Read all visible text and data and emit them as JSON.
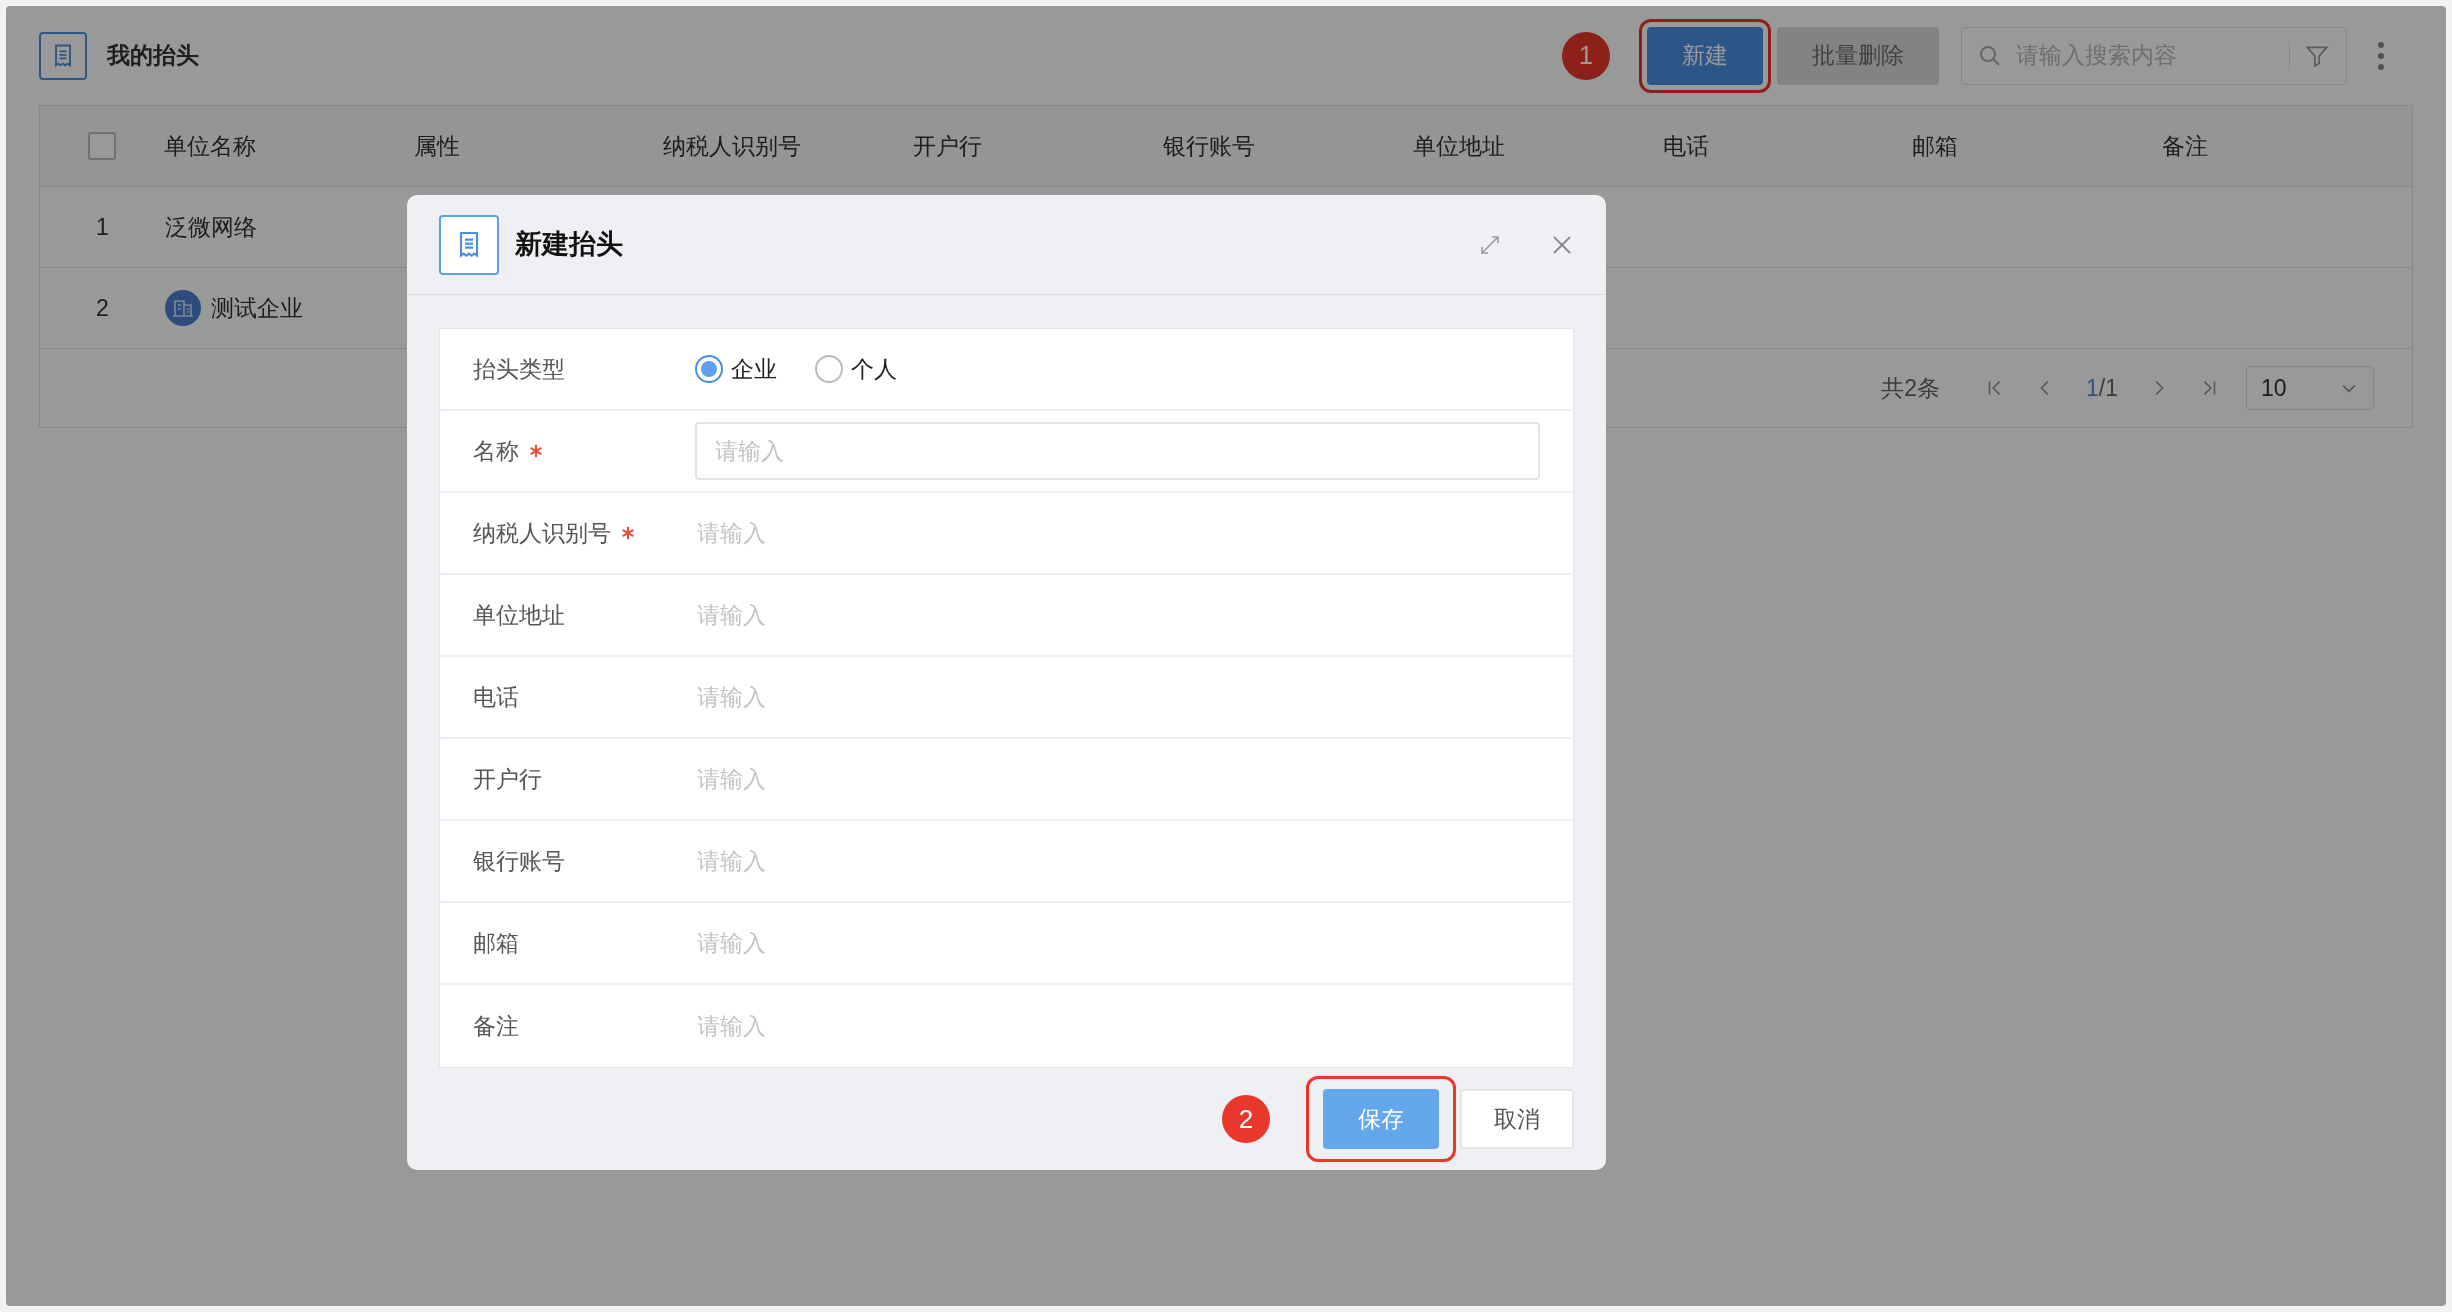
{
  "page": {
    "title": "我的抬头"
  },
  "toolbar": {
    "annotation": "1",
    "new_button": "新建",
    "batch_delete": {
      "label": "批量删除",
      "disabled": true
    },
    "search": {
      "placeholder": "请输入搜索内容"
    }
  },
  "table": {
    "select_all_checked": false,
    "columns": [
      "单位名称",
      "属性",
      "纳税人识别号",
      "开户行",
      "银行账号",
      "单位地址",
      "电话",
      "邮箱",
      "备注"
    ],
    "rows": [
      {
        "index": "1",
        "name": "泛微网络",
        "icon": false
      },
      {
        "index": "2",
        "name": "测试企业",
        "icon": true
      }
    ]
  },
  "pagination": {
    "total": "共2条",
    "current": "1",
    "rest": "/1",
    "page_size": "10"
  },
  "dialog": {
    "title": "新建抬头",
    "fields": [
      {
        "label": "抬头类型",
        "required": false,
        "kind": "radio",
        "options": [
          {
            "label": "企业",
            "selected": true
          },
          {
            "label": "个人",
            "selected": false
          }
        ]
      },
      {
        "label": "名称",
        "required": true,
        "kind": "boxed",
        "placeholder": "请输入"
      },
      {
        "label": "纳税人识别号",
        "required": true,
        "kind": "plain",
        "placeholder": "请输入"
      },
      {
        "label": "单位地址",
        "required": false,
        "kind": "plain",
        "placeholder": "请输入"
      },
      {
        "label": "电话",
        "required": false,
        "kind": "plain",
        "placeholder": "请输入"
      },
      {
        "label": "开户行",
        "required": false,
        "kind": "plain",
        "placeholder": "请输入"
      },
      {
        "label": "银行账号",
        "required": false,
        "kind": "plain",
        "placeholder": "请输入"
      },
      {
        "label": "邮箱",
        "required": false,
        "kind": "plain",
        "placeholder": "请输入"
      },
      {
        "label": "备注",
        "required": false,
        "kind": "plain",
        "placeholder": "请输入"
      }
    ],
    "annotation": "2",
    "save_button": "保存",
    "cancel_button": "取消"
  }
}
